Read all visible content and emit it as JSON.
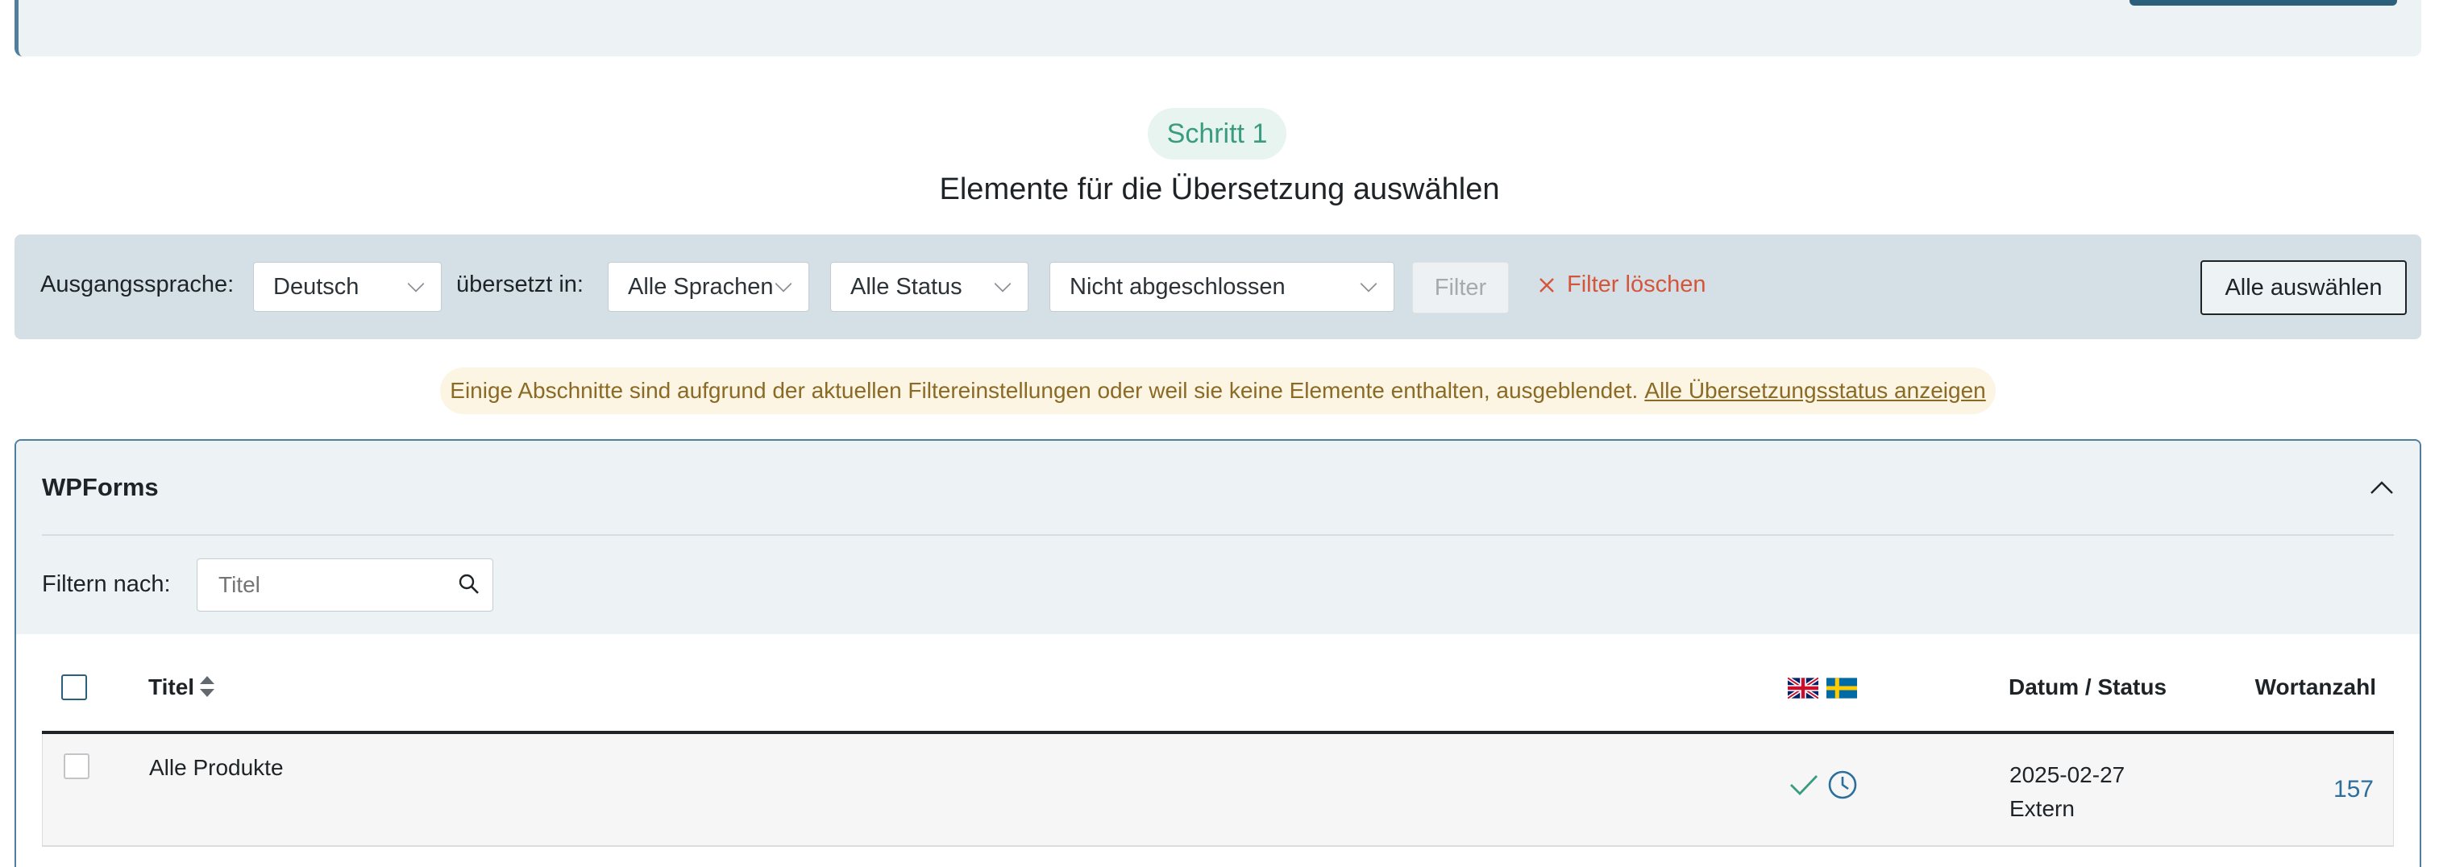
{
  "step": {
    "badge": "Schritt 1",
    "title": "Elemente für die Übersetzung auswählen"
  },
  "filter_bar": {
    "source_label": "Ausgangssprache:",
    "source_value": "Deutsch",
    "translated_label": "übersetzt in:",
    "languages_value": "Alle Sprachen",
    "status_value": "Alle Status",
    "completion_value": "Nicht abgeschlossen",
    "filter_button": "Filter",
    "clear_filter": "Filter löschen",
    "select_all": "Alle auswählen"
  },
  "notice": {
    "text": "Einige Abschnitte sind aufgrund der aktuellen Filtereinstellungen oder weil sie keine Elemente enthalten, ausgeblendet.",
    "link": "Alle Übersetzungsstatus anzeigen"
  },
  "section": {
    "title": "WPForms",
    "filter_label": "Filtern nach:",
    "search_placeholder": "Titel"
  },
  "table": {
    "headers": {
      "title": "Titel",
      "date_status": "Datum / Status",
      "word_count": "Wortanzahl"
    },
    "rows": [
      {
        "title": "Alle Produkte",
        "date": "2025-02-27",
        "status": "Extern",
        "word_count": "157",
        "translations": [
          "check-icon",
          "clock-icon"
        ]
      }
    ]
  },
  "colors": {
    "accent": "#2c5f7c",
    "check": "#3a9c7e",
    "clear": "#d6553a",
    "notice_text": "#8a6a24"
  }
}
